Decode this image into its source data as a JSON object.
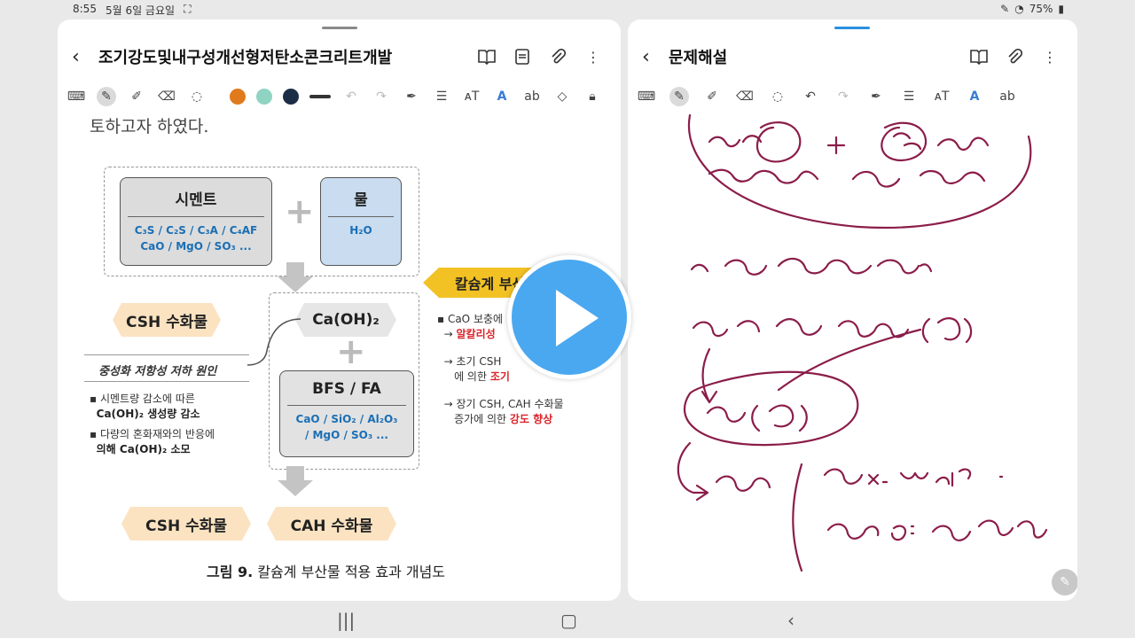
{
  "status": {
    "time": "8:55",
    "date": "5월 6일 금요일",
    "battery": "75%"
  },
  "left_pane": {
    "title": "조기강도및내구성개선형저탄소콘크리트개발",
    "top_text": "토하고자 하였다.",
    "cement_box": {
      "title": "시멘트",
      "line1": "C₃S / C₂S / C₃A / C₄AF",
      "line2": "CaO / MgO / SO₃ ..."
    },
    "water_box": {
      "title": "물",
      "sub": "H₂O"
    },
    "csh_left": "CSH 수화물",
    "caoh": "Ca(OH)₂",
    "bfs_box": {
      "title": "BFS / FA",
      "line1": "CaO / SiO₂ / Al₂O₃",
      "line2": "/ MgO / SO₃ ..."
    },
    "neutral_label": "중성화 저항성 저하 원인",
    "notes_left": [
      {
        "a": "시멘트량 감소에 따른",
        "b": "Ca(OH)₂ 생성량 감소"
      },
      {
        "a": "다량의 혼화재와의 반응에",
        "b": "의해 Ca(OH)₂ 소모"
      }
    ],
    "banner": "칼슘계 부산물",
    "notes_right": {
      "n1": "CaO 보충에",
      "n1b": "알칼리성",
      "n2": "초기 CSH",
      "n2b": "에 의한",
      "n2c": "조기",
      "n3": "장기 CSH, CAH 수화물",
      "n3b": "증가에 의한",
      "n3c": "강도 향상"
    },
    "csh_bottom": "CSH 수화물",
    "cah_bottom": "CAH 수화물",
    "caption_bold": "그림 9.",
    "caption_text": "칼슘계 부산물 적용 효과 개념도"
  },
  "right_pane": {
    "title": "문제해설"
  },
  "colors": {
    "orange": "#e07a1c",
    "teal": "#8fd3c3",
    "navy": "#1c2e45",
    "ink": "#8b1d4a",
    "accent": "#2a8fe0"
  }
}
